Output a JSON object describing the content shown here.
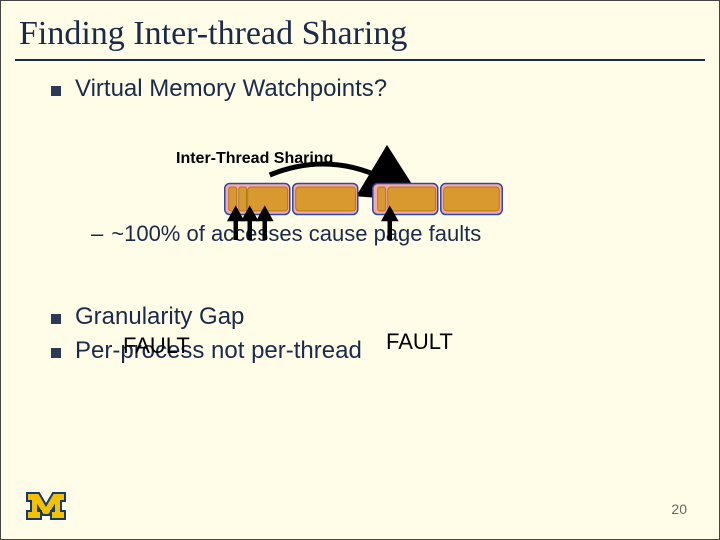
{
  "title": "Finding Inter-thread Sharing",
  "bullets": {
    "b1": "Virtual Memory Watchpoints?",
    "b2": "Granularity Gap",
    "b3": "Per-process not per-thread"
  },
  "sub": {
    "line": "~100% of accesses cause page faults"
  },
  "labels": {
    "its": "Inter-Thread Sharing",
    "fault1": "FAULT",
    "fault2": "FAULT"
  },
  "page_number": "20",
  "logo_letter": "M",
  "colors": {
    "page_fill": "#f7a9a9",
    "page_stroke": "#2c4aa0",
    "block_fill": "#d89a2e",
    "block_stroke": "#a06a10",
    "arrow": "#000000",
    "logo_maize": "#f2c200",
    "logo_blue": "#173a6b"
  }
}
